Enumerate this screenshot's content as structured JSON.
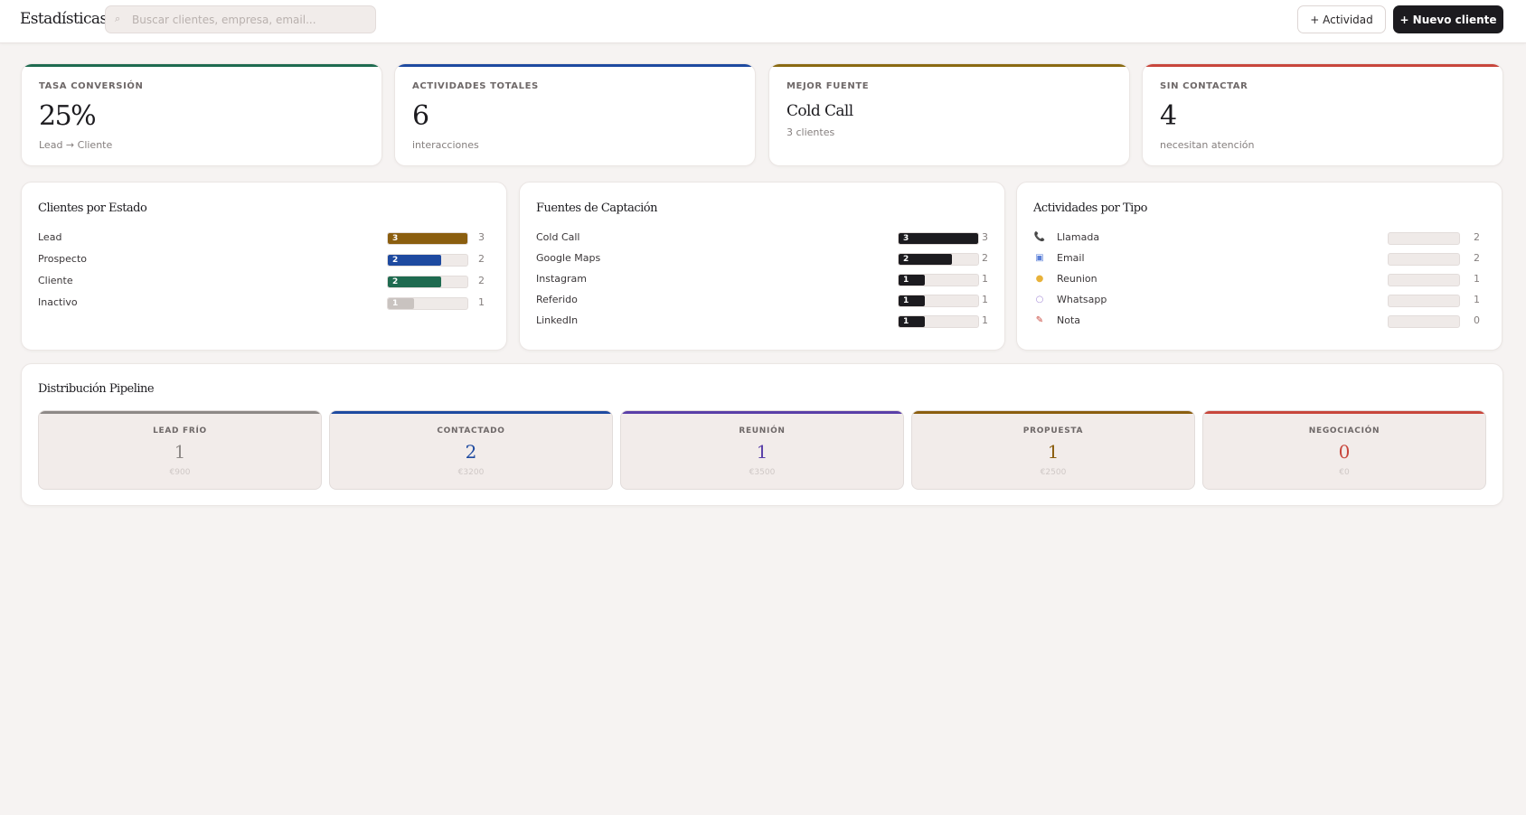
{
  "header": {
    "title": "Estadísticas",
    "search_placeholder": "Buscar clientes, empresa, email...",
    "search_icon": "⌕",
    "activity_button": "+ Actividad",
    "new_client_button": "+ Nuevo cliente"
  },
  "stats": [
    {
      "label": "TASA CONVERSIÓN",
      "value": "25%",
      "sub": "Lead → Cliente",
      "accent": "#1f6b50"
    },
    {
      "label": "ACTIVIDADES TOTALES",
      "value": "6",
      "sub": "interacciones",
      "accent": "#1e4aa0"
    },
    {
      "label": "MEJOR FUENTE",
      "value": "Cold Call",
      "sub": "3 clientes",
      "accent": "#8a6a12"
    },
    {
      "label": "SIN CONTACTAR",
      "value": "4",
      "sub": "necesitan atención",
      "accent": "#c8463c"
    }
  ],
  "clientes_por_estado": {
    "title": "Clientes por Estado",
    "max": 3,
    "rows": [
      {
        "label": "Lead",
        "value": 3,
        "color": "#8b5e0f"
      },
      {
        "label": "Prospecto",
        "value": 2,
        "color": "#1e4aa0"
      },
      {
        "label": "Cliente",
        "value": 2,
        "color": "#1f6b50"
      },
      {
        "label": "Inactivo",
        "value": 1,
        "color": "#c9c3c0"
      }
    ]
  },
  "fuentes": {
    "title": "Fuentes de Captación",
    "max": 3,
    "rows": [
      {
        "label": "Cold Call",
        "value": 3,
        "color": "#1c1b1f"
      },
      {
        "label": "Google Maps",
        "value": 2,
        "color": "#1c1b1f"
      },
      {
        "label": "Instagram",
        "value": 1,
        "color": "#1c1b1f"
      },
      {
        "label": "Referido",
        "value": 1,
        "color": "#1c1b1f"
      },
      {
        "label": "LinkedIn",
        "value": 1,
        "color": "#1c1b1f"
      }
    ]
  },
  "actividades": {
    "title": "Actividades por Tipo",
    "rows": [
      {
        "label": "Llamada",
        "count": "2",
        "icon": "phone-icon",
        "glyph": "📞",
        "glyph_color": "#d0385a"
      },
      {
        "label": "Email",
        "count": "2",
        "icon": "email-icon",
        "glyph": "▣",
        "glyph_color": "#5a7fd8"
      },
      {
        "label": "Reunion",
        "count": "1",
        "icon": "handshake-icon",
        "glyph": "●",
        "glyph_color": "#e8b23a"
      },
      {
        "label": "Whatsapp",
        "count": "1",
        "icon": "chat-bubble-icon",
        "glyph": "○",
        "glyph_color": "#a88fd8"
      },
      {
        "label": "Nota",
        "count": "0",
        "icon": "note-icon",
        "glyph": "✎",
        "glyph_color": "#c8463c"
      }
    ]
  },
  "pipeline": {
    "title": "Distribución Pipeline",
    "stages": [
      {
        "label": "LEAD FRÍO",
        "count": "1",
        "amount": "€900",
        "color": "#8e8987",
        "num_color": "#8e8987"
      },
      {
        "label": "CONTACTADO",
        "count": "2",
        "amount": "€3200",
        "color": "#1e4aa0",
        "num_color": "#1e4aa0"
      },
      {
        "label": "REUNIÓN",
        "count": "1",
        "amount": "€3500",
        "color": "#5a3fa8",
        "num_color": "#5a3fa8"
      },
      {
        "label": "PROPUESTA",
        "count": "1",
        "amount": "€2500",
        "color": "#8b5e0f",
        "num_color": "#8b5e0f"
      },
      {
        "label": "NEGOCIACIÓN",
        "count": "0",
        "amount": "€0",
        "color": "#c8463c",
        "num_color": "#c8463c"
      }
    ]
  }
}
